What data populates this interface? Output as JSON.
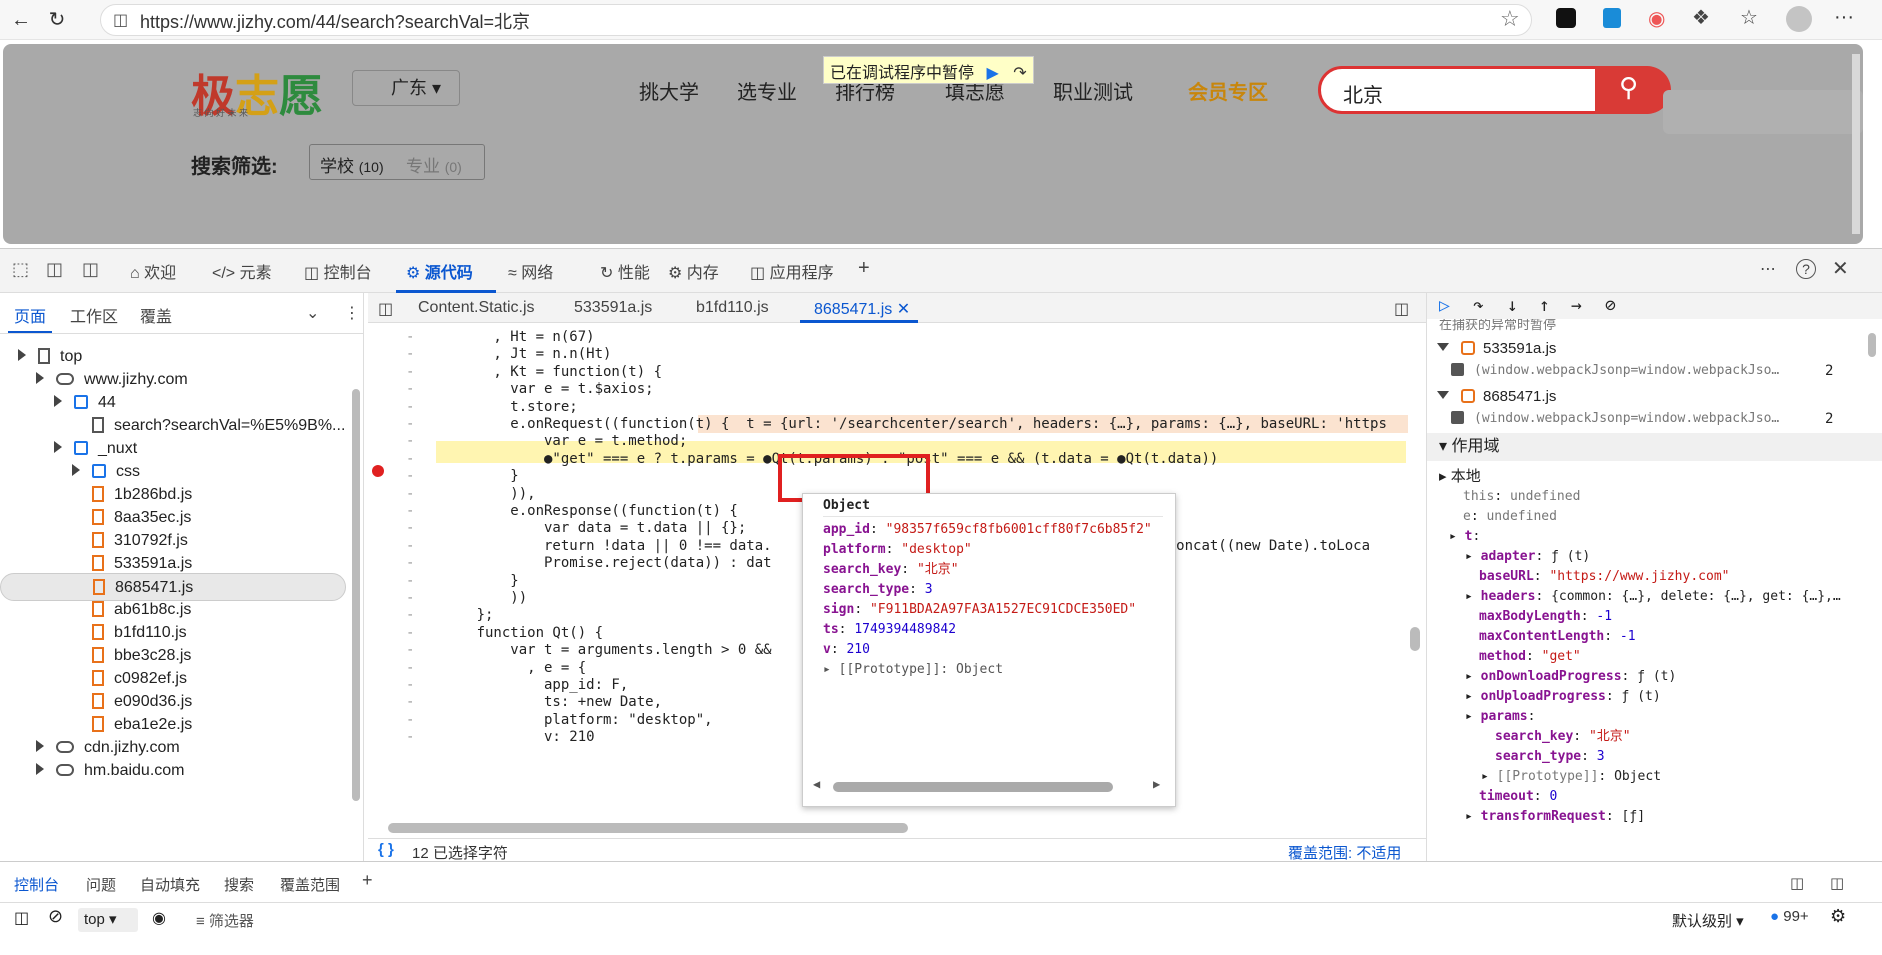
{
  "browser": {
    "url": "https://www.jizhy.com/44/search?searchVal=北京",
    "back_icon": "arrow-left-icon",
    "reload_icon": "reload-icon",
    "more": "···"
  },
  "site": {
    "logo": {
      "c1": "极",
      "c2": "志",
      "c3": "愿",
      "tagline": "志 向 好 未 来"
    },
    "region": "广东",
    "nav": [
      "挑大学",
      "选专业",
      "排行榜",
      "填志愿",
      "职业测试",
      "会员专区"
    ],
    "search_value": "北京",
    "filter_label": "搜索筛选:",
    "filter_school": "学校",
    "filter_school_count": "(10)",
    "filter_major": "专业",
    "filter_major_count": "(0)",
    "paused_text": "已在调试程序中暂停"
  },
  "devtools": {
    "tabs": [
      "欢迎",
      "元素",
      "控制台",
      "源代码",
      "网络",
      "性能",
      "内存",
      "应用程序"
    ],
    "active_tab": "源代码",
    "left_tabs": [
      "页面",
      "工作区",
      "覆盖"
    ],
    "tree": [
      {
        "label": "top",
        "type": "frame",
        "indent": 0
      },
      {
        "label": "www.jizhy.com",
        "type": "cloud",
        "indent": 1
      },
      {
        "label": "44",
        "type": "folder",
        "indent": 2
      },
      {
        "label": "search?searchVal=%E5%9B%...",
        "type": "doc",
        "indent": 3
      },
      {
        "label": "_nuxt",
        "type": "folder",
        "indent": 2
      },
      {
        "label": "css",
        "type": "folder",
        "indent": 3
      },
      {
        "label": "1b286bd.js",
        "type": "file",
        "indent": 3
      },
      {
        "label": "8aa35ec.js",
        "type": "file",
        "indent": 3
      },
      {
        "label": "310792f.js",
        "type": "file",
        "indent": 3
      },
      {
        "label": "533591a.js",
        "type": "file",
        "indent": 3
      },
      {
        "label": "8685471.js",
        "type": "file",
        "indent": 3,
        "selected": true
      },
      {
        "label": "ab61b8c.js",
        "type": "file",
        "indent": 3
      },
      {
        "label": "b1fd110.js",
        "type": "file",
        "indent": 3
      },
      {
        "label": "bbe3c28.js",
        "type": "file",
        "indent": 3
      },
      {
        "label": "c0982ef.js",
        "type": "file",
        "indent": 3
      },
      {
        "label": "e090d36.js",
        "type": "file",
        "indent": 3
      },
      {
        "label": "eba1e2e.js",
        "type": "file",
        "indent": 3
      },
      {
        "label": "cdn.jizhy.com",
        "type": "cloud",
        "indent": 1
      },
      {
        "label": "hm.baidu.com",
        "type": "cloud",
        "indent": 1
      }
    ],
    "editor_tabs": [
      "Content.Static.js",
      "533591a.js",
      "b1fd110.js",
      "8685471.js"
    ],
    "active_editor_tab": "8685471.js",
    "code_lines": [
      "        , Ht = n(67)",
      "        , Jt = n.n(Ht)",
      "        , Kt = function(t) {",
      "          var e = t.$axios;",
      "          t.store;",
      "          e.onRequest((function(t) {  t = {url: '/searchcenter/search', headers: {…}, params: {…}, baseURL: 'https",
      "              var e = t.method;",
      "              ●\"get\" === e ? t.params = ●Qt(t.params) : \"post\" === e && (t.data = ●Qt(t.data))",
      "          }",
      "          )),",
      "          e.onResponse((function(t) {",
      "              var data = t.data || {};",
      "              return !data || 0 !== data.                                          \": \".concat((new Date).toLoca",
      "              Promise.reject(data)) : dat",
      "          }",
      "          ))",
      "      };",
      "      function Qt() {",
      "          var t = arguments.length > 0 &&",
      "            , e = {",
      "              app_id: F,",
      "              ts: +new Date,",
      "              platform: \"desktop\",",
      "              v: 210"
    ],
    "popup": {
      "title": "Object",
      "entries": [
        {
          "k": "app_id",
          "v": "\"98357f659cf8fb6001cff80f7c6b85f2\"",
          "t": "str"
        },
        {
          "k": "platform",
          "v": "\"desktop\"",
          "t": "str"
        },
        {
          "k": "search_key",
          "v": "\"北京\"",
          "t": "str"
        },
        {
          "k": "search_type",
          "v": "3",
          "t": "num"
        },
        {
          "k": "sign",
          "v": "\"F911BDA2A97FA3A1527EC91CDCE350ED\"",
          "t": "str"
        },
        {
          "k": "ts",
          "v": "1749394489842",
          "t": "num"
        },
        {
          "k": "v",
          "v": "210",
          "t": "num"
        }
      ],
      "proto": "[[Prototype]]: Object"
    },
    "editor_status": "12 已选择字符",
    "coverage": "覆盖范围: 不适用",
    "right": {
      "top_text": "在捕获的异常时暂停",
      "bp_files": [
        {
          "file": "533591a.js",
          "snippet": "(window.webpackJsonp=window.webpackJso…",
          "count": "2"
        },
        {
          "file": "8685471.js",
          "snippet": "(window.webpackJsonp=window.webpackJso…",
          "count": "2"
        }
      ],
      "scope_title": "作用域",
      "local": "本地",
      "vars": [
        {
          "k": "this",
          "v": "undefined",
          "cls": "rg",
          "indent": 0,
          "bold": false
        },
        {
          "k": "e",
          "v": "undefined",
          "cls": "rg",
          "indent": 0,
          "bold": false
        },
        {
          "k": "t",
          "v": "",
          "cls": "",
          "indent": 0,
          "bold": true
        },
        {
          "k": "adapter",
          "v": "ƒ (t)",
          "cls": "",
          "indent": 1,
          "bold": true
        },
        {
          "k": "baseURL",
          "v": "\"https://www.jizhy.com\"",
          "cls": "rv",
          "indent": 1,
          "bold": true
        },
        {
          "k": "headers",
          "v": "{common: {…}, delete: {…}, get: {…},…",
          "cls": "",
          "indent": 1,
          "bold": true
        },
        {
          "k": "maxBodyLength",
          "v": "-1",
          "cls": "rn",
          "indent": 1,
          "bold": true
        },
        {
          "k": "maxContentLength",
          "v": "-1",
          "cls": "rn",
          "indent": 1,
          "bold": true
        },
        {
          "k": "method",
          "v": "\"get\"",
          "cls": "rv",
          "indent": 1,
          "bold": true
        },
        {
          "k": "onDownloadProgress",
          "v": "ƒ (t)",
          "cls": "",
          "indent": 1,
          "bold": true
        },
        {
          "k": "onUploadProgress",
          "v": "ƒ (t)",
          "cls": "",
          "indent": 1,
          "bold": true
        },
        {
          "k": "params",
          "v": "",
          "cls": "",
          "indent": 1,
          "bold": true
        },
        {
          "k": "search_key",
          "v": "\"北京\"",
          "cls": "rv",
          "indent": 2,
          "bold": true
        },
        {
          "k": "search_type",
          "v": "3",
          "cls": "rn",
          "indent": 2,
          "bold": true
        },
        {
          "k": "[[Prototype]]",
          "v": "Object",
          "cls": "",
          "indent": 2,
          "bold": false
        },
        {
          "k": "timeout",
          "v": "0",
          "cls": "rn",
          "indent": 1,
          "bold": true
        },
        {
          "k": "transformRequest",
          "v": "[ƒ]",
          "cls": "",
          "indent": 1,
          "bold": true
        }
      ]
    },
    "console": {
      "tabs": [
        "控制台",
        "问题",
        "自动填充",
        "搜索",
        "覆盖范围"
      ],
      "context": "top",
      "filter": "筛选器",
      "level": "默认级别",
      "count": "99+"
    }
  }
}
